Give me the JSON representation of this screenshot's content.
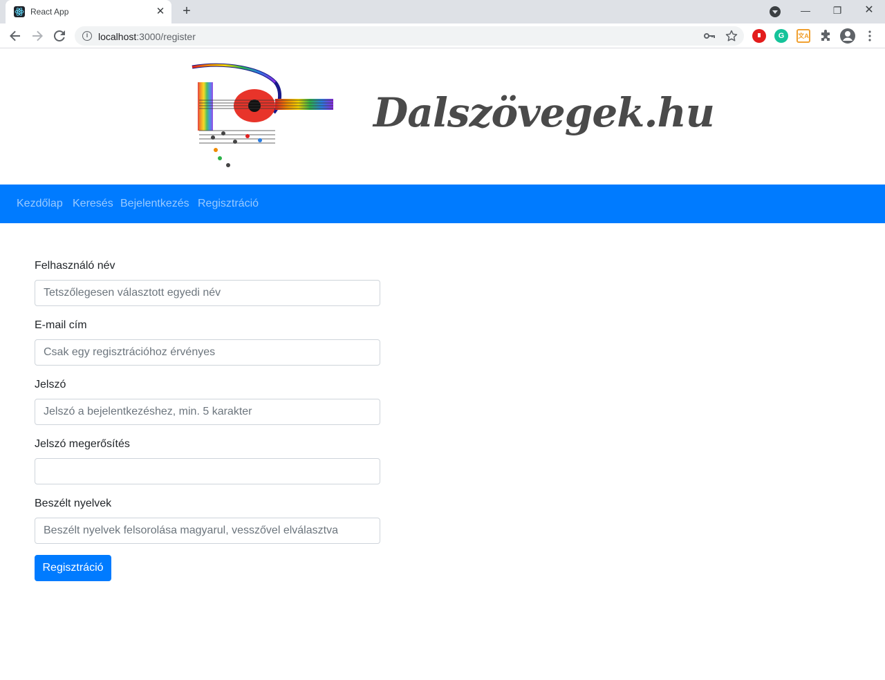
{
  "browser": {
    "tab_title": "React App",
    "tab_close": "✕",
    "new_tab": "+",
    "url_host": "localhost",
    "url_path": ":3000/register",
    "window": {
      "minimize": "—",
      "restore": "❐",
      "close": "✕"
    }
  },
  "site": {
    "logo_text": "Dalszövegek.hu"
  },
  "navbar": {
    "items": [
      {
        "label": "Kezdőlap"
      },
      {
        "label": "Keresés"
      },
      {
        "label": "Bejelentkezés"
      },
      {
        "label": "Regisztráció"
      }
    ]
  },
  "form": {
    "username": {
      "label": "Felhasználó név",
      "placeholder": "Tetszőlegesen választott egyedi név",
      "value": ""
    },
    "email": {
      "label": "E-mail cím",
      "placeholder": "Csak egy regisztrációhoz érvényes",
      "value": ""
    },
    "password": {
      "label": "Jelszó",
      "placeholder": "Jelszó a bejelentkezéshez, min. 5 karakter",
      "value": ""
    },
    "password_confirm": {
      "label": "Jelszó megerősítés",
      "placeholder": "",
      "value": ""
    },
    "languages": {
      "label": "Beszélt nyelvek",
      "placeholder": "Beszélt nyelvek felsorolása magyarul, vesszővel elválasztva",
      "value": ""
    },
    "submit_label": "Regisztráció"
  },
  "colors": {
    "primary": "#007bff",
    "navbar_link": "rgba(255,255,255,0.6)",
    "text": "#212529"
  },
  "icons": {
    "favicon": "react-icon",
    "back": "arrow-left-icon",
    "forward": "arrow-right-icon",
    "reload": "reload-icon",
    "site_info": "info-icon",
    "key": "key-icon",
    "bookmark": "star-icon",
    "extensions": "puzzle-icon",
    "profile": "profile-icon",
    "menu": "more-vert-icon"
  }
}
